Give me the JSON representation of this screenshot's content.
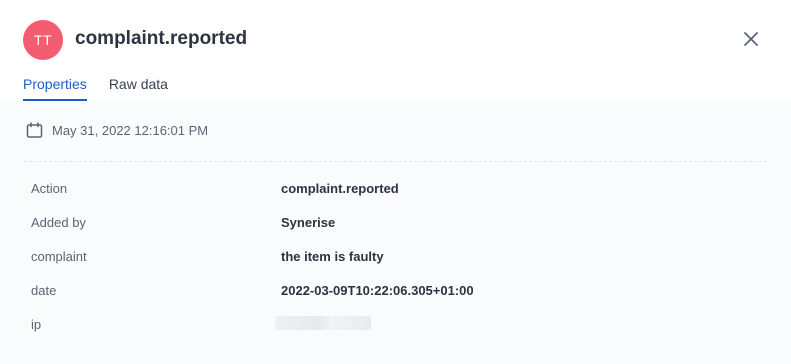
{
  "header": {
    "avatar_initials": "TT",
    "avatar_color": "#f45d71",
    "title": "complaint.reported",
    "close_icon": "close-icon"
  },
  "tabs": [
    {
      "label": "Properties",
      "active": true
    },
    {
      "label": "Raw data",
      "active": false
    }
  ],
  "event": {
    "date_icon": "calendar-icon",
    "date": "May 31, 2022 12:16:01 PM"
  },
  "properties": [
    {
      "key": "Action",
      "value": "complaint.reported"
    },
    {
      "key": "Added by",
      "value": "Synerise"
    },
    {
      "key": "complaint",
      "value": "the item is faulty"
    },
    {
      "key": "date",
      "value": "2022-03-09T10:22:06.305+01:00"
    },
    {
      "key": "ip",
      "value": ""
    }
  ],
  "colors": {
    "accent": "#1d5cc8",
    "text": "#2b3440",
    "muted": "#5a6573"
  }
}
